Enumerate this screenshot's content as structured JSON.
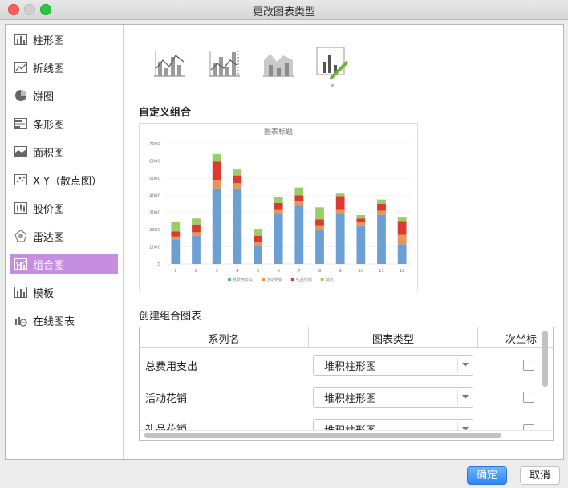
{
  "window": {
    "title": "更改图表类型"
  },
  "sidebar": {
    "items": [
      {
        "label": "柱形图",
        "icon": "column-chart-icon"
      },
      {
        "label": "折线图",
        "icon": "line-chart-icon"
      },
      {
        "label": "饼图",
        "icon": "pie-chart-icon"
      },
      {
        "label": "条形图",
        "icon": "bar-chart-icon"
      },
      {
        "label": "面积图",
        "icon": "area-chart-icon"
      },
      {
        "label": "X Y（散点图）",
        "icon": "scatter-chart-icon"
      },
      {
        "label": "股价图",
        "icon": "stock-chart-icon"
      },
      {
        "label": "雷达图",
        "icon": "radar-chart-icon"
      },
      {
        "label": "组合图",
        "icon": "combo-chart-icon",
        "active": true
      },
      {
        "label": "模板",
        "icon": "template-icon"
      },
      {
        "label": "在线图表",
        "icon": "online-chart-icon"
      }
    ]
  },
  "templates": [
    "combo-column-line-icon",
    "combo-column-line-secondary-icon",
    "combo-area-column-icon",
    "custom-combo-icon"
  ],
  "section": {
    "custom_title": "自定义组合",
    "create_title": "创建组合图表"
  },
  "chart_data": {
    "type": "bar",
    "stacked": true,
    "title": "图表标题",
    "categories": [
      "1",
      "2",
      "3",
      "4",
      "5",
      "6",
      "7",
      "8",
      "9",
      "10",
      "11",
      "12"
    ],
    "ylim": [
      0,
      7000
    ],
    "yticks": [
      "0",
      "1000",
      "2000",
      "3000",
      "4000",
      "5000",
      "6000",
      "7000"
    ],
    "series": [
      {
        "name": "总费用支出",
        "color": "#6c9fd4",
        "values": [
          1400,
          1650,
          4400,
          4400,
          1050,
          2900,
          3400,
          2000,
          2900,
          2250,
          2850,
          1150
        ]
      },
      {
        "name": "活动花销",
        "color": "#e8955a",
        "values": [
          200,
          200,
          500,
          300,
          250,
          250,
          250,
          250,
          250,
          200,
          250,
          550
        ]
      },
      {
        "name": "礼品花销",
        "color": "#d93a34",
        "values": [
          300,
          450,
          1050,
          450,
          350,
          400,
          350,
          350,
          800,
          200,
          400,
          800
        ]
      },
      {
        "name": "其他",
        "color": "#9bcc68",
        "values": [
          550,
          350,
          450,
          350,
          400,
          350,
          450,
          700,
          150,
          200,
          250,
          250
        ]
      }
    ]
  },
  "table": {
    "headers": [
      "系列名",
      "图表类型",
      "次坐标"
    ],
    "rows": [
      {
        "name": "总费用支出",
        "type": "堆积柱形图"
      },
      {
        "name": "活动花销",
        "type": "堆积柱形图"
      },
      {
        "name": "礼品花销",
        "type": "堆积柱形图"
      }
    ]
  },
  "buttons": {
    "ok": "确定",
    "cancel": "取消"
  }
}
